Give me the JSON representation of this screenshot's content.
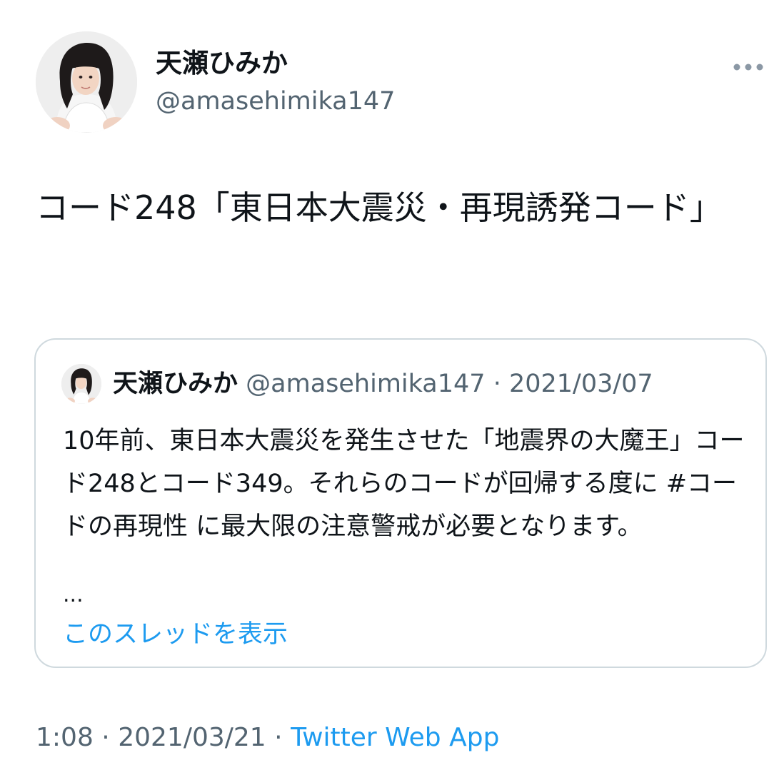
{
  "author": {
    "display_name": "天瀬ひみか",
    "handle": "@amasehimika147",
    "avatar": "avatar-photo"
  },
  "more_icon": "more-horizontal-icon",
  "tweet": {
    "text": "コード248「東日本大震災・再現誘発コード」"
  },
  "quote": {
    "display_name": "天瀬ひみか",
    "handle": "@amasehimika147",
    "separator": "·",
    "date": "2021/03/07",
    "body": "10年前、東日本大震災を発生させた「地震界の大魔王」コード248とコード349。それらのコードが回帰する度に #コードの再現性 に最大限の注意警戒が必要となります。",
    "ellipsis": "...",
    "show_thread": "このスレッドを表示"
  },
  "meta": {
    "time": "1:08",
    "separator": "·",
    "date": "2021/03/21",
    "source": "Twitter Web App"
  },
  "colors": {
    "text": "#0f1419",
    "secondary": "#536471",
    "link": "#1d9bf0",
    "border": "#cfd9de"
  }
}
